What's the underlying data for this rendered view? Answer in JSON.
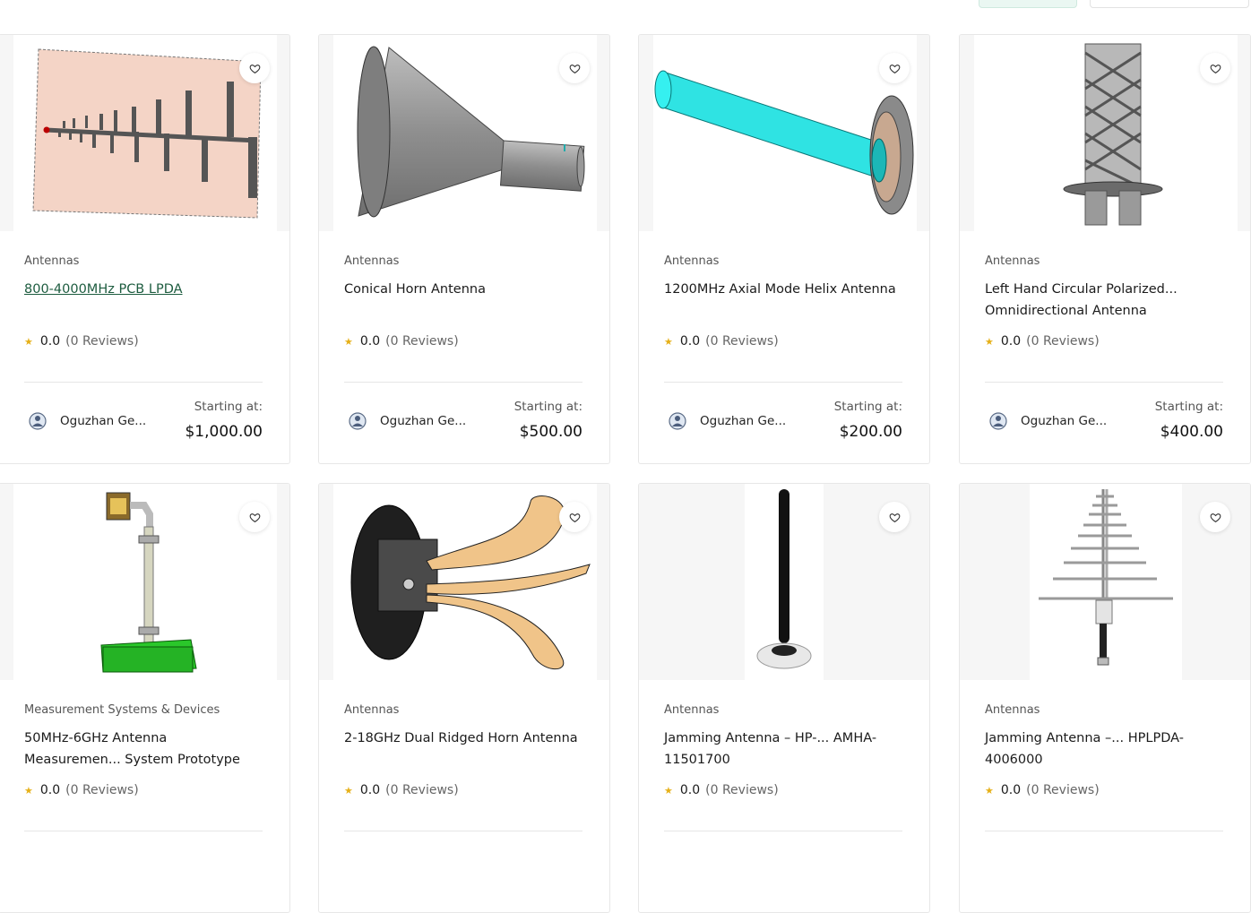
{
  "products": [
    {
      "category": "Antennas",
      "title": "800-4000MHz PCB LPDA",
      "score": "0.0",
      "reviews": "(0 Reviews)",
      "seller": "Oguzhan Ge...",
      "price_label": "Starting at:",
      "price": "$1,000.00",
      "image": "pcb-lpda-image"
    },
    {
      "category": "Antennas",
      "title": "Conical Horn Antenna",
      "score": "0.0",
      "reviews": "(0 Reviews)",
      "seller": "Oguzhan Ge...",
      "price_label": "Starting at:",
      "price": "$500.00",
      "image": "conical-horn-image"
    },
    {
      "category": "Antennas",
      "title": "1200MHz Axial Mode Helix Antenna",
      "score": "0.0",
      "reviews": "(0 Reviews)",
      "seller": "Oguzhan Ge...",
      "price_label": "Starting at:",
      "price": "$200.00",
      "image": "helix-antenna-image"
    },
    {
      "category": "Antennas",
      "title": "Left Hand Circular Polarized... Omnidirectional Antenna",
      "score": "0.0",
      "reviews": "(0 Reviews)",
      "seller": "Oguzhan Ge...",
      "price_label": "Starting at:",
      "price": "$400.00",
      "image": "omni-antenna-image"
    },
    {
      "category": "Measurement Systems & Devices",
      "title": "50MHz-6GHz Antenna Measuremen... System Prototype",
      "score": "0.0",
      "reviews": "(0 Reviews)",
      "image": "measurement-system-image"
    },
    {
      "category": "Antennas",
      "title": "2-18GHz Dual Ridged Horn Antenna",
      "score": "0.0",
      "reviews": "(0 Reviews)",
      "image": "ridged-horn-image"
    },
    {
      "category": "Antennas",
      "title": "Jamming Antenna – HP-... AMHA-11501700",
      "score": "0.0",
      "reviews": "(0 Reviews)",
      "image": "jamming-whip-image"
    },
    {
      "category": "Antennas",
      "title": "Jamming Antenna –... HPLPDA-4006000",
      "score": "0.0",
      "reviews": "(0 Reviews)",
      "image": "jamming-lpda-image"
    }
  ],
  "icons": {
    "favorite": "heart-icon",
    "star": "star-icon",
    "seller_avatar": "seller-logo-icon"
  },
  "colors": {
    "star": "#e6b018",
    "link": "#1d5c3f",
    "accent_pill": "#eaf7f2"
  }
}
